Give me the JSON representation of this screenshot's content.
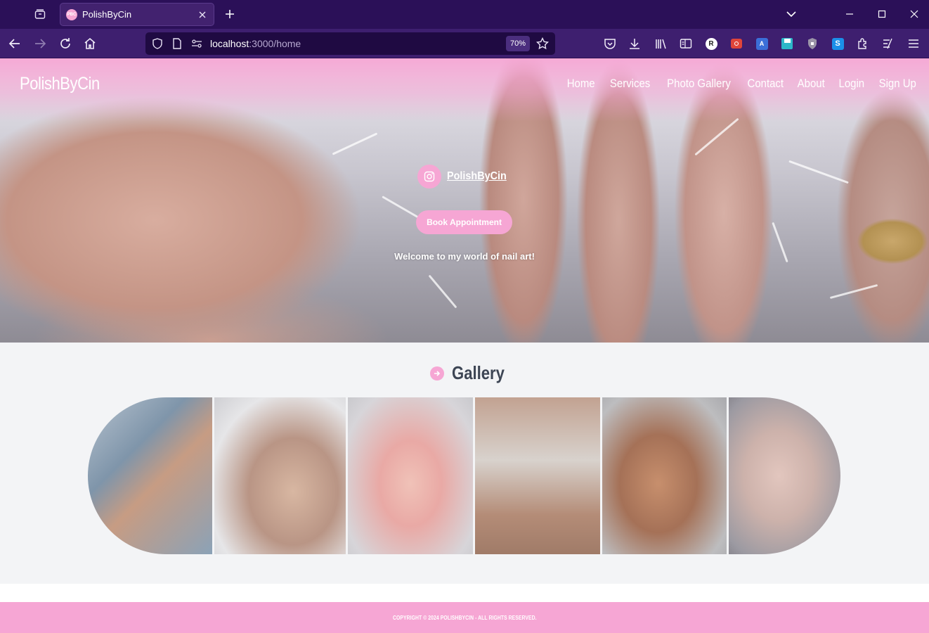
{
  "browser": {
    "tab_title": "PolishByCin",
    "tab_favicon_text": "PBC",
    "url_host": "localhost",
    "url_path": ":3000/home",
    "zoom": "70%"
  },
  "site": {
    "logo": "PolishByCin",
    "nav": [
      "Home",
      "Services",
      "Photo Gallery",
      "Contact",
      "About",
      "Login",
      "Sign Up"
    ],
    "instagram_handle": "PolishByCin",
    "book_button": "Book Appointment",
    "welcome": "Welcome to my world of nail art!",
    "gallery_title": "Gallery",
    "footer": "COPYRIGHT © 2024 POLISHBYCIN - ALL RIGHTS RESERVED."
  },
  "colors": {
    "brand_pink": "#f6a6d4",
    "browser_tabbar": "#2b1058",
    "browser_toolbar": "#3e1f6f"
  }
}
